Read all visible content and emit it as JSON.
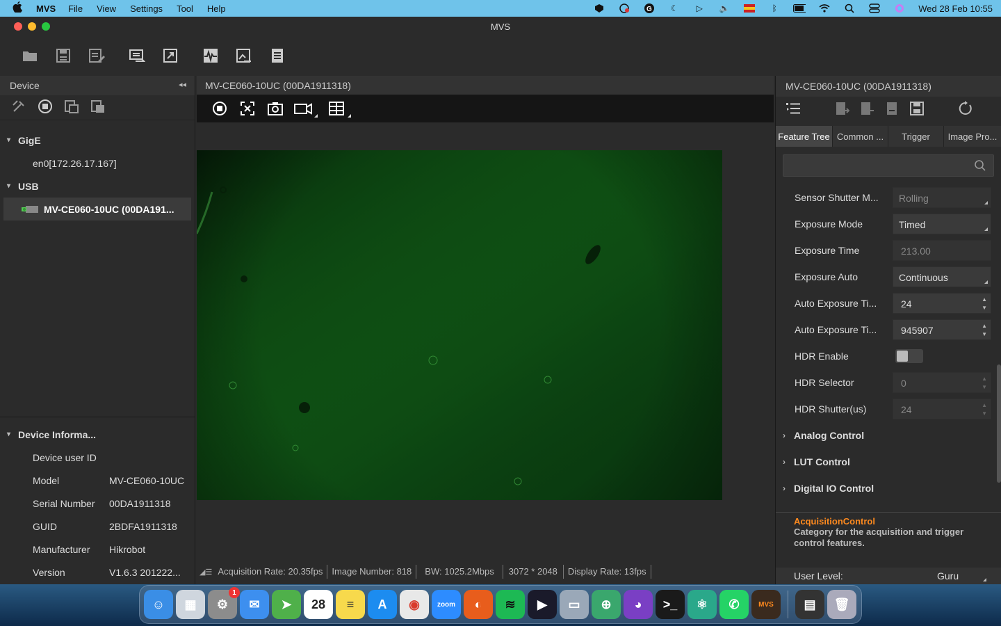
{
  "menubar": {
    "app_name": "MVS",
    "menus": [
      "File",
      "View",
      "Settings",
      "Tool",
      "Help"
    ],
    "clock": "Wed 28 Feb  10:55",
    "icons": [
      "shield-icon",
      "vpn-icon",
      "grammarly-icon",
      "moon-icon",
      "play-icon",
      "volume-icon",
      "flag-icon",
      "bluetooth-icon",
      "battery-icon",
      "wifi-icon",
      "search-icon",
      "control-center-icon",
      "siri-icon"
    ]
  },
  "window": {
    "title": "MVS"
  },
  "toolbar": {
    "buttons": [
      "open-folder-icon",
      "save-icon",
      "save-as-icon",
      "switch-view-icon",
      "fullscreen-icon",
      "waveform-icon",
      "image-edit-icon",
      "log-icon"
    ]
  },
  "left_panel": {
    "title": "Device",
    "tree": {
      "gige_label": "GigE",
      "gige_item": "en0[172.26.17.167]",
      "usb_label": "USB",
      "usb_device": "MV-CE060-10UC (00DA191..."
    },
    "device_info": {
      "title": "Device Informa...",
      "rows": [
        {
          "key": "Device user ID",
          "value": ""
        },
        {
          "key": "Model",
          "value": "MV-CE060-10UC"
        },
        {
          "key": "Serial Number",
          "value": "00DA1911318"
        },
        {
          "key": "GUID",
          "value": "2BDFA1911318"
        },
        {
          "key": "Manufacturer",
          "value": "Hikrobot"
        },
        {
          "key": "Version",
          "value": "V1.6.3 201222..."
        }
      ]
    }
  },
  "center": {
    "title": "MV-CE060-10UC (00DA1911318)",
    "status": {
      "acq_rate": "Acquisition Rate: 20.35fps",
      "image_number": "Image Number: 818",
      "bw": "BW: 1025.2Mbps",
      "resolution": "3072 * 2048",
      "display_rate": "Display Rate: 13fps"
    }
  },
  "right_panel": {
    "title": "MV-CE060-10UC (00DA1911318)",
    "tabs": [
      "Feature Tree",
      "Common ...",
      "Trigger",
      "Image Pro..."
    ],
    "search_placeholder": "",
    "props": {
      "sensor_shutter": {
        "label": "Sensor Shutter M...",
        "value": "Rolling"
      },
      "exposure_mode": {
        "label": "Exposure Mode",
        "value": "Timed"
      },
      "exposure_time": {
        "label": "Exposure Time",
        "value": "213.00"
      },
      "exposure_auto": {
        "label": "Exposure Auto",
        "value": "Continuous"
      },
      "auto_exp_low": {
        "label": "Auto Exposure Ti...",
        "value": "24"
      },
      "auto_exp_high": {
        "label": "Auto Exposure Ti...",
        "value": "945907"
      },
      "hdr_enable": {
        "label": "HDR Enable"
      },
      "hdr_selector": {
        "label": "HDR Selector",
        "value": "0"
      },
      "hdr_shutter": {
        "label": "HDR Shutter(us)",
        "value": "24"
      }
    },
    "categories": {
      "analog": "Analog Control",
      "lut": "LUT Control",
      "digital_io": "Digital IO Control"
    },
    "description": {
      "title": "AcquisitionControl",
      "text": "Category for the acquisition and trigger control features."
    },
    "user_level": {
      "label": "User Level:",
      "value": "Guru"
    }
  },
  "dock": {
    "apps": [
      {
        "name": "Finder",
        "color": "#3a8ee6",
        "glyph": "☺"
      },
      {
        "name": "Launchpad",
        "color": "#cfd6de",
        "glyph": "▦"
      },
      {
        "name": "System Settings",
        "color": "#8c8c8c",
        "glyph": "⚙",
        "badge": "1"
      },
      {
        "name": "Mail",
        "color": "#3d8fef",
        "glyph": "✉"
      },
      {
        "name": "Maps",
        "color": "#4fb04a",
        "glyph": "➤"
      },
      {
        "name": "Calendar",
        "color": "#ffffff",
        "glyph": "28",
        "text_color": "#222"
      },
      {
        "name": "Notes",
        "color": "#f7d94c",
        "glyph": "≡",
        "text_color": "#333"
      },
      {
        "name": "App Store",
        "color": "#1c8cf0",
        "glyph": "A"
      },
      {
        "name": "Chrome",
        "color": "#e8e8e8",
        "glyph": "◉",
        "text_color": "#d93a2b"
      },
      {
        "name": "Zoom",
        "color": "#2d8cff",
        "glyph": "zoom"
      },
      {
        "name": "Firefox",
        "color": "#e85d1c",
        "glyph": "◐"
      },
      {
        "name": "Spotify",
        "color": "#1db954",
        "glyph": "≋",
        "text_color": "#111"
      },
      {
        "name": "Cursor",
        "color": "#1a1a2a",
        "glyph": "▶"
      },
      {
        "name": "Preview",
        "color": "#9aa8b8",
        "glyph": "▭"
      },
      {
        "name": "Network",
        "color": "#3aa76d",
        "glyph": "⊕"
      },
      {
        "name": "GitHub",
        "color": "#7a3fc4",
        "glyph": "◕"
      },
      {
        "name": "Terminal",
        "color": "#1a1a1a",
        "glyph": ">_"
      },
      {
        "name": "Atom",
        "color": "#2aa88a",
        "glyph": "⚛"
      },
      {
        "name": "WhatsApp",
        "color": "#25d366",
        "glyph": "✆"
      },
      {
        "name": "MVS",
        "color": "#3a2a1e",
        "glyph": "MVS",
        "text_color": "#ff8a1e"
      }
    ],
    "extras": [
      {
        "name": "Downloads",
        "color": "#333",
        "glyph": "▤"
      },
      {
        "name": "Trash",
        "color": "#aab",
        "glyph": "🗑"
      }
    ]
  }
}
